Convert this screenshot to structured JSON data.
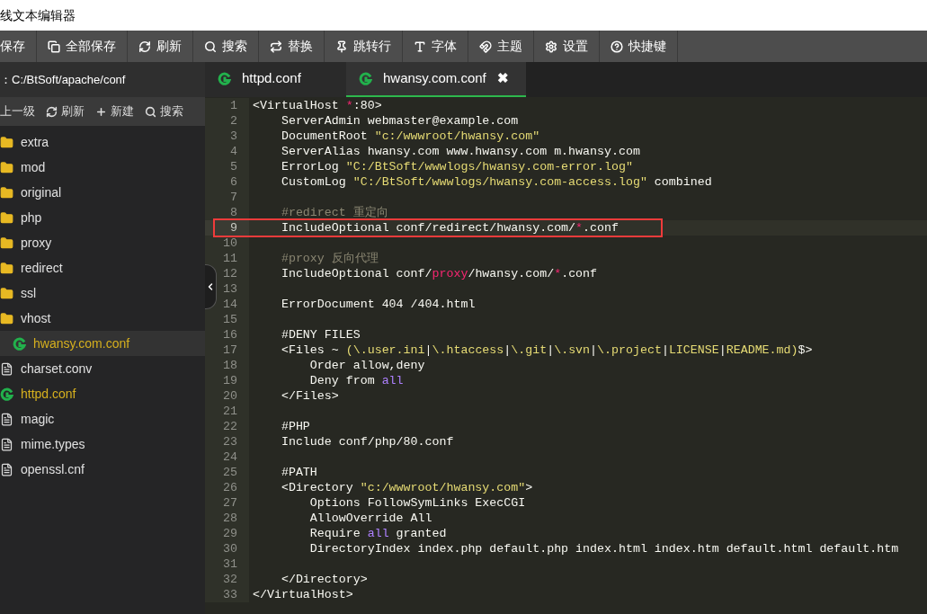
{
  "window": {
    "title": "线文本编辑器"
  },
  "toolbar": [
    {
      "label": "保存",
      "kind": "plain"
    },
    {
      "label": "全部保存",
      "kind": "copy"
    },
    {
      "label": "刷新",
      "kind": "refresh"
    },
    {
      "label": "搜索",
      "kind": "search"
    },
    {
      "label": "替换",
      "kind": "replace"
    },
    {
      "label": "跳转行",
      "kind": "pin"
    },
    {
      "label": "字体",
      "kind": "font"
    },
    {
      "label": "主题",
      "kind": "magnet"
    },
    {
      "label": "设置",
      "kind": "gear"
    },
    {
      "label": "快捷键",
      "kind": "help"
    }
  ],
  "sidebar": {
    "path": "：C:/BtSoft/apache/conf",
    "actions": [
      {
        "label": "上一级",
        "kind": "plain"
      },
      {
        "label": "刷新",
        "kind": "refresh"
      },
      {
        "label": "新建",
        "kind": "plus"
      },
      {
        "label": "搜索",
        "kind": "search"
      }
    ],
    "items": [
      {
        "kind": "folder",
        "name": "extra",
        "selected": false,
        "open": false
      },
      {
        "kind": "folder",
        "name": "mod",
        "selected": false,
        "open": false
      },
      {
        "kind": "folder",
        "name": "original",
        "selected": false,
        "open": false
      },
      {
        "kind": "folder",
        "name": "php",
        "selected": false,
        "open": false
      },
      {
        "kind": "folder",
        "name": "proxy",
        "selected": false,
        "open": false
      },
      {
        "kind": "folder",
        "name": "redirect",
        "selected": false,
        "open": false
      },
      {
        "kind": "folder",
        "name": "ssl",
        "selected": false,
        "open": false
      },
      {
        "kind": "folder",
        "name": "vhost",
        "selected": false,
        "open": false,
        "children": [
          {
            "kind": "conf",
            "name": "hwansy.com.conf",
            "selected": true,
            "open": true
          }
        ]
      },
      {
        "kind": "file",
        "name": "charset.conv",
        "selected": false,
        "open": false
      },
      {
        "kind": "conf",
        "name": "httpd.conf",
        "selected": false,
        "open": true
      },
      {
        "kind": "file",
        "name": "magic",
        "selected": false,
        "open": false
      },
      {
        "kind": "file",
        "name": "mime.types",
        "selected": false,
        "open": false
      },
      {
        "kind": "file",
        "name": "openssl.cnf",
        "selected": false,
        "open": false
      }
    ]
  },
  "tabs": [
    {
      "label": "httpd.conf",
      "selected": false
    },
    {
      "label": "hwansy.com.conf",
      "selected": true,
      "close": "✖"
    }
  ],
  "editor": {
    "lines": [
      {
        "number": "1",
        "highlighted": false,
        "tokens": [
          {
            "kind": "plain",
            "text": "<VirtualHost "
          },
          {
            "kind": "keyword",
            "text": "*"
          },
          {
            "kind": "plain",
            "text": ":80>"
          }
        ]
      },
      {
        "number": "2",
        "highlighted": false,
        "tokens": [
          {
            "kind": "plain",
            "text": "    ServerAdmin webmaster@example.com"
          }
        ]
      },
      {
        "number": "3",
        "highlighted": false,
        "tokens": [
          {
            "kind": "plain",
            "text": "    DocumentRoot "
          },
          {
            "kind": "string",
            "text": "\"c:/wwwroot/hwansy.com\""
          }
        ]
      },
      {
        "number": "4",
        "highlighted": false,
        "tokens": [
          {
            "kind": "plain",
            "text": "    ServerAlias hwansy.com www.hwansy.com m.hwansy.com"
          }
        ]
      },
      {
        "number": "5",
        "highlighted": false,
        "tokens": [
          {
            "kind": "plain",
            "text": "    ErrorLog "
          },
          {
            "kind": "string",
            "text": "\"C:/BtSoft/wwwlogs/hwansy.com-error.log\""
          }
        ]
      },
      {
        "number": "6",
        "highlighted": false,
        "tokens": [
          {
            "kind": "plain",
            "text": "    CustomLog "
          },
          {
            "kind": "string",
            "text": "\"C:/BtSoft/wwwlogs/hwansy.com-access.log\""
          },
          {
            "kind": "plain",
            "text": " combined"
          }
        ]
      },
      {
        "number": "7",
        "highlighted": false
      },
      {
        "number": "8",
        "highlighted": false,
        "tokens": [
          {
            "kind": "comment",
            "text": "    #redirect 重定向"
          }
        ]
      },
      {
        "number": "9",
        "highlighted": true,
        "tokens": [
          {
            "kind": "plain",
            "text": "    IncludeOptional conf/redirect/hwansy.com/"
          },
          {
            "kind": "keyword",
            "text": "*"
          },
          {
            "kind": "plain",
            "text": ".conf"
          }
        ]
      },
      {
        "number": "10",
        "highlighted": false
      },
      {
        "number": "11",
        "highlighted": false,
        "tokens": [
          {
            "kind": "comment",
            "text": "    #proxy 反向代理"
          }
        ]
      },
      {
        "number": "12",
        "highlighted": false,
        "tokens": [
          {
            "kind": "plain",
            "text": "    IncludeOptional conf/"
          },
          {
            "kind": "keyword",
            "text": "proxy"
          },
          {
            "kind": "plain",
            "text": "/hwansy.com/"
          },
          {
            "kind": "keyword",
            "text": "*"
          },
          {
            "kind": "plain",
            "text": ".conf"
          }
        ]
      },
      {
        "number": "13",
        "highlighted": false
      },
      {
        "number": "14",
        "highlighted": false,
        "tokens": [
          {
            "kind": "plain",
            "text": "    ErrorDocument 404 /404.html"
          }
        ]
      },
      {
        "number": "15",
        "highlighted": false
      },
      {
        "number": "16",
        "highlighted": false,
        "tokens": [
          {
            "kind": "plain",
            "text": "    #DENY FILES"
          }
        ]
      },
      {
        "number": "17",
        "highlighted": false,
        "tokens": [
          {
            "kind": "plain",
            "text": "    <Files ~ "
          },
          {
            "kind": "string",
            "text": "(\\.user.ini"
          },
          {
            "kind": "plain",
            "text": "|"
          },
          {
            "kind": "string",
            "text": "\\.htaccess"
          },
          {
            "kind": "plain",
            "text": "|"
          },
          {
            "kind": "string",
            "text": "\\.git"
          },
          {
            "kind": "plain",
            "text": "|"
          },
          {
            "kind": "string",
            "text": "\\.svn"
          },
          {
            "kind": "plain",
            "text": "|"
          },
          {
            "kind": "string",
            "text": "\\.project"
          },
          {
            "kind": "plain",
            "text": "|"
          },
          {
            "kind": "string",
            "text": "LICENSE"
          },
          {
            "kind": "plain",
            "text": "|"
          },
          {
            "kind": "string",
            "text": "README.md)"
          },
          {
            "kind": "plain",
            "text": "$>"
          }
        ]
      },
      {
        "number": "18",
        "highlighted": false,
        "tokens": [
          {
            "kind": "plain",
            "text": "        Order allow,deny"
          }
        ]
      },
      {
        "number": "19",
        "highlighted": false,
        "tokens": [
          {
            "kind": "plain",
            "text": "        Deny from "
          },
          {
            "kind": "constant",
            "text": "all"
          }
        ]
      },
      {
        "number": "20",
        "highlighted": false,
        "tokens": [
          {
            "kind": "plain",
            "text": "    </Files>"
          }
        ]
      },
      {
        "number": "21",
        "highlighted": false
      },
      {
        "number": "22",
        "highlighted": false,
        "tokens": [
          {
            "kind": "plain",
            "text": "    #PHP"
          }
        ]
      },
      {
        "number": "23",
        "highlighted": false,
        "tokens": [
          {
            "kind": "plain",
            "text": "    Include conf/php/80.conf"
          }
        ]
      },
      {
        "number": "24",
        "highlighted": false
      },
      {
        "number": "25",
        "highlighted": false,
        "tokens": [
          {
            "kind": "plain",
            "text": "    #PATH"
          }
        ]
      },
      {
        "number": "26",
        "highlighted": false,
        "tokens": [
          {
            "kind": "plain",
            "text": "    <Directory "
          },
          {
            "kind": "string",
            "text": "\"c:/wwwroot/hwansy.com\""
          },
          {
            "kind": "plain",
            "text": ">"
          }
        ]
      },
      {
        "number": "27",
        "highlighted": false,
        "tokens": [
          {
            "kind": "plain",
            "text": "        Options FollowSymLinks ExecCGI"
          }
        ]
      },
      {
        "number": "28",
        "highlighted": false,
        "tokens": [
          {
            "kind": "plain",
            "text": "        AllowOverride All"
          }
        ]
      },
      {
        "number": "29",
        "highlighted": false,
        "tokens": [
          {
            "kind": "plain",
            "text": "        Require "
          },
          {
            "kind": "constant",
            "text": "all"
          },
          {
            "kind": "plain",
            "text": " granted"
          }
        ]
      },
      {
        "number": "30",
        "highlighted": false,
        "tokens": [
          {
            "kind": "plain",
            "text": "        DirectoryIndex index.php default.php index.html index.htm default.html default.htm"
          }
        ]
      },
      {
        "number": "31",
        "highlighted": false
      },
      {
        "number": "32",
        "highlighted": false,
        "tokens": [
          {
            "kind": "plain",
            "text": "    </Directory>"
          }
        ]
      },
      {
        "number": "33",
        "highlighted": false,
        "tokens": [
          {
            "kind": "plain",
            "text": "</VirtualHost>"
          }
        ]
      }
    ]
  }
}
